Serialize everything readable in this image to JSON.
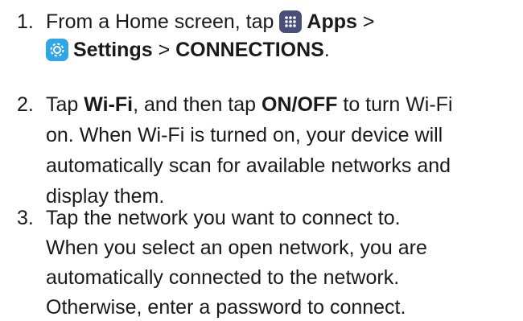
{
  "steps": [
    {
      "number": "1.",
      "line1": {
        "text1": "From a Home screen, tap ",
        "apps_icon": "apps-icon",
        "apps": "Apps",
        "sep": " >"
      },
      "line2": {
        "settings_icon": "settings-gear-icon",
        "settings": "Settings",
        "sep": " > ",
        "connections": "CONNECTIONS",
        "end": "."
      }
    },
    {
      "number": "2.",
      "line1": {
        "text1": "Tap ",
        "wifi": "Wi-Fi",
        "text2": ", and then tap ",
        "onoff": "ON/OFF",
        "text3": " to turn Wi-Fi"
      },
      "line2": "on. When Wi-Fi is turned on, your device will",
      "line3": "automatically scan for available networks and",
      "line4": "display them."
    },
    {
      "number": "3.",
      "line1": "Tap the network you want to connect to.",
      "line2": "When you select an open network, you are",
      "line3": "automatically connected to the network.",
      "line4": "Otherwise, enter a password to connect."
    }
  ],
  "colors": {
    "text": "#1a1a1a",
    "apps_icon_bg": "#4a4f7a",
    "settings_icon_bg": "#2fa6e8"
  }
}
